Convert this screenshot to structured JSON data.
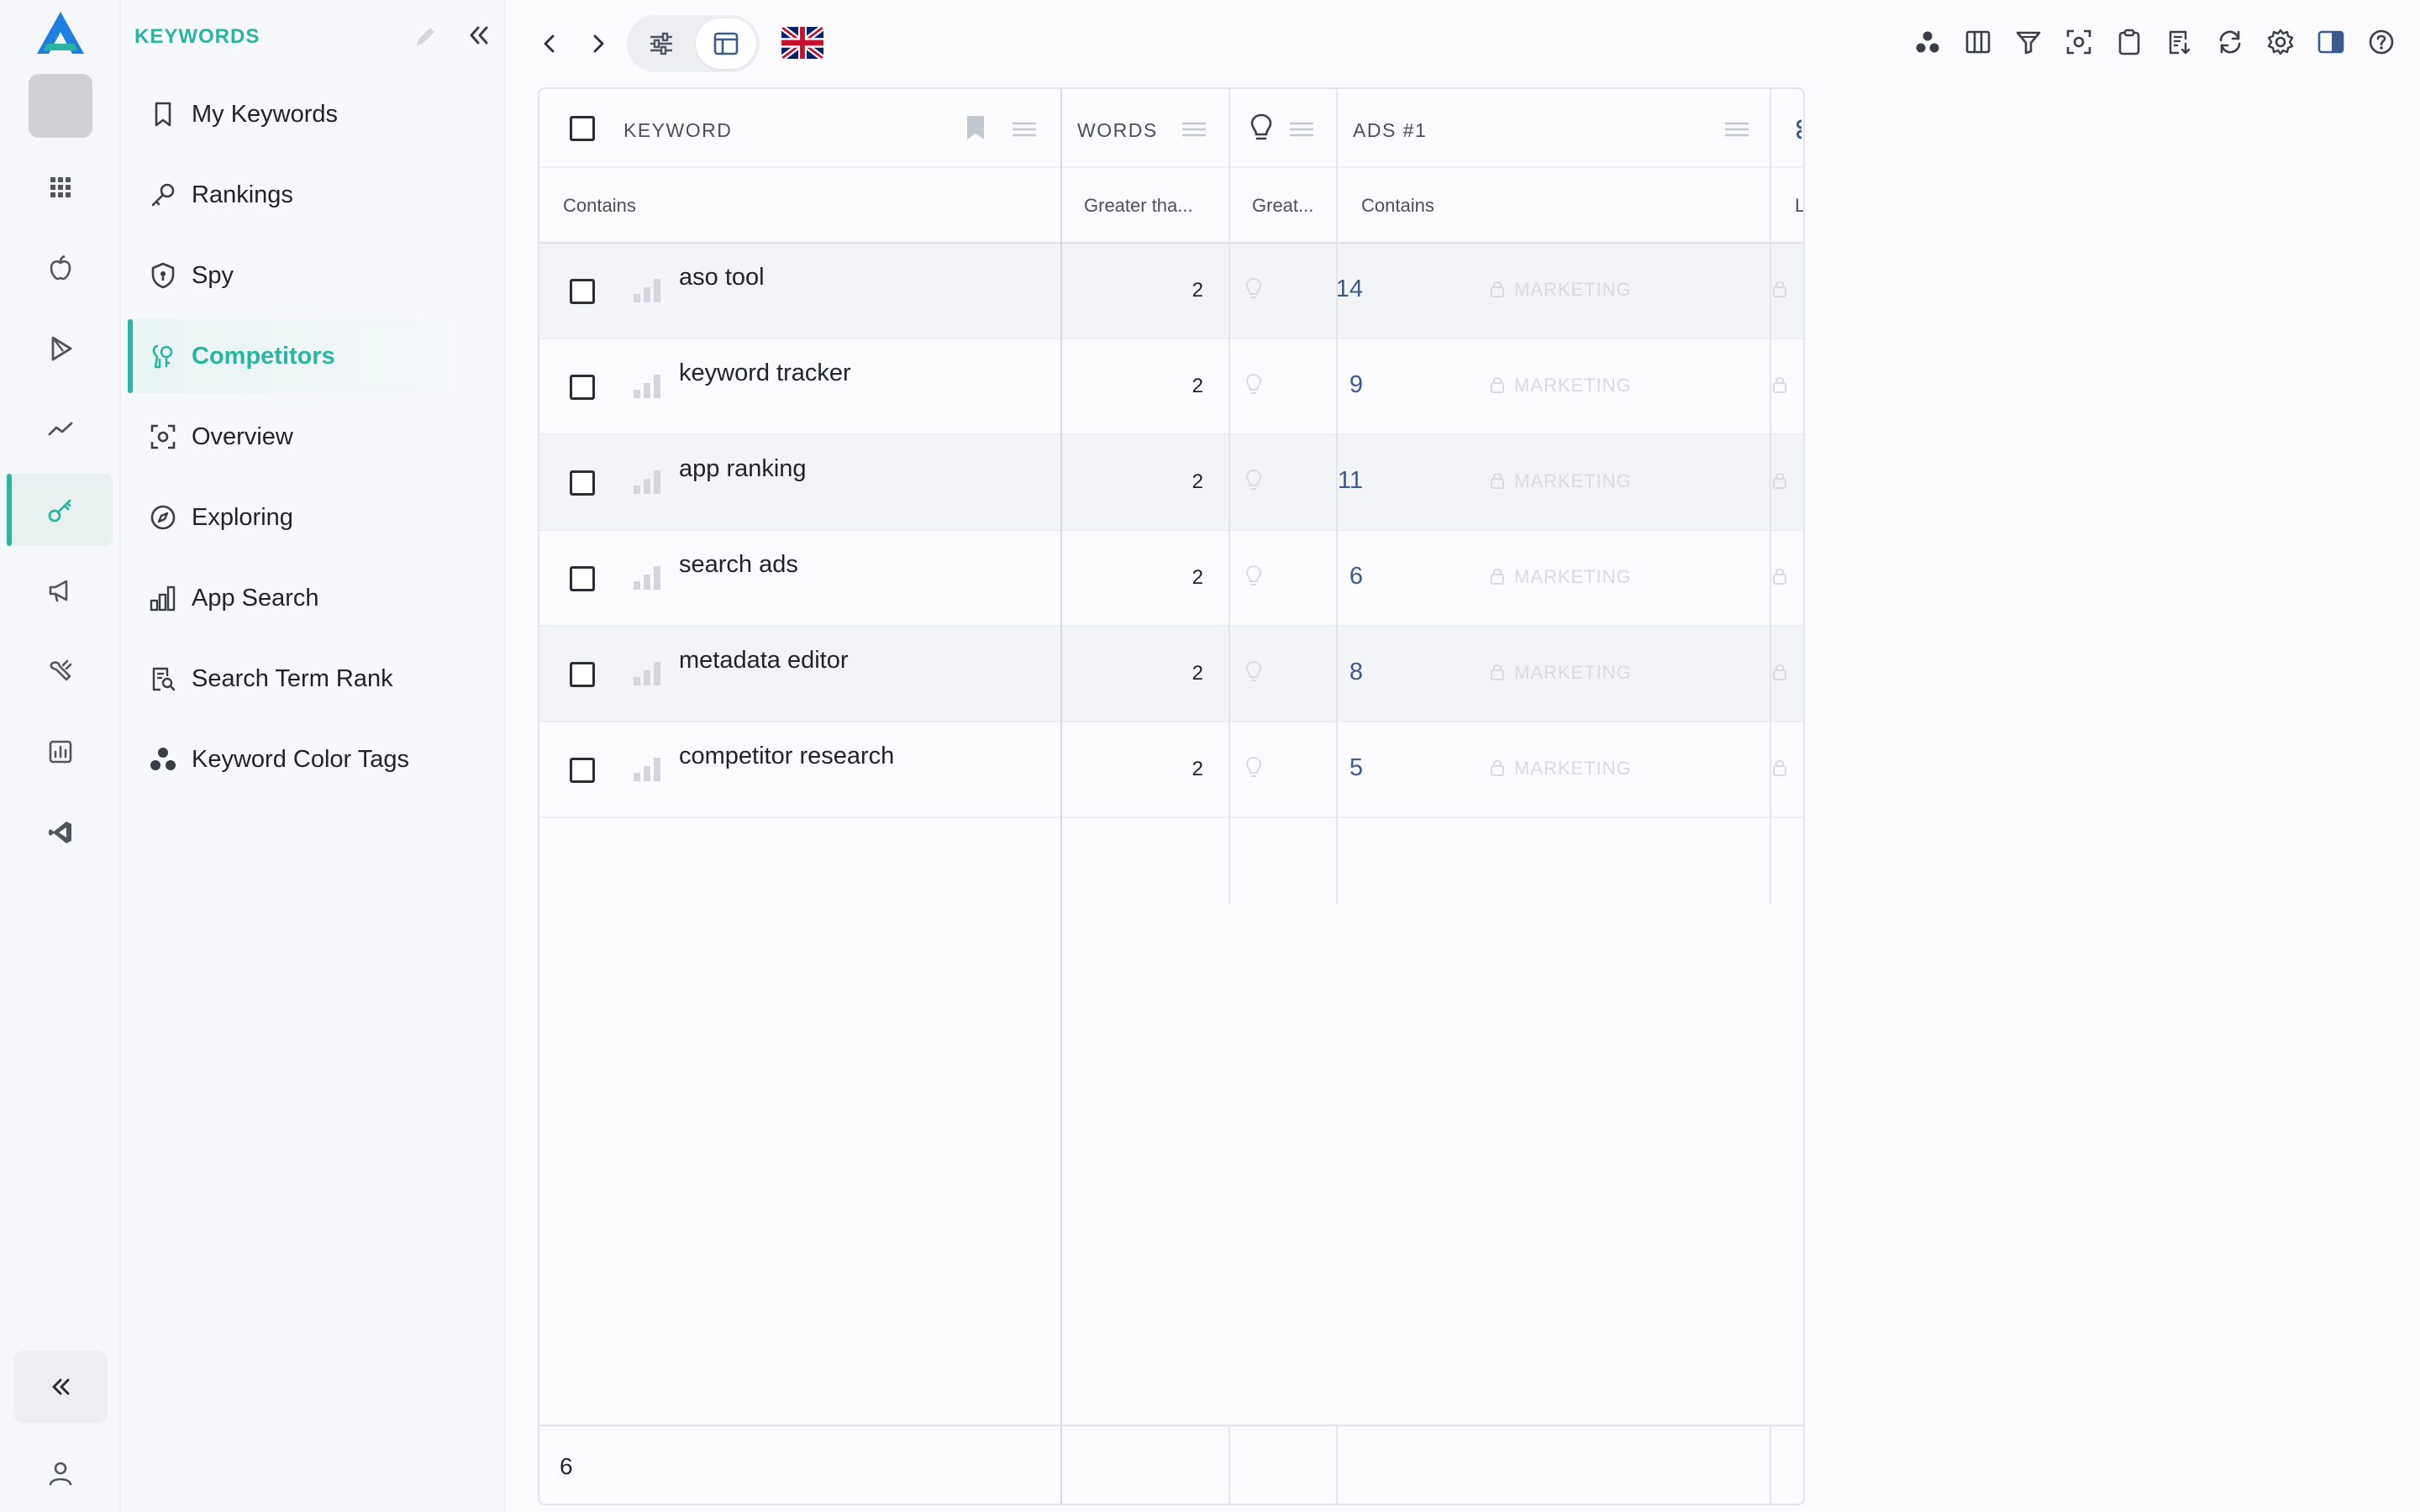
{
  "sidebar": {
    "title": "KEYWORDS",
    "items": [
      {
        "label": "My Keywords"
      },
      {
        "label": "Rankings"
      },
      {
        "label": "Spy"
      },
      {
        "label": "Competitors"
      },
      {
        "label": "Overview"
      },
      {
        "label": "Exploring"
      },
      {
        "label": "App Search"
      },
      {
        "label": "Search Term Rank"
      },
      {
        "label": "Keyword Color Tags"
      }
    ]
  },
  "table": {
    "headers": {
      "keyword": "KEYWORD",
      "words": "WORDS",
      "ads": "ADS #1"
    },
    "filters": {
      "keyword": "Contains",
      "words": "Greater tha...",
      "suggestions": "Great...",
      "ads": "Contains",
      "edge": "L"
    },
    "rows": [
      {
        "keyword": "aso tool",
        "words": "2",
        "suggestions": "14",
        "ads": "MARKETING"
      },
      {
        "keyword": "keyword tracker",
        "words": "2",
        "suggestions": "9",
        "ads": "MARKETING"
      },
      {
        "keyword": "app ranking",
        "words": "2",
        "suggestions": "11",
        "ads": "MARKETING"
      },
      {
        "keyword": "search ads",
        "words": "2",
        "suggestions": "6",
        "ads": "MARKETING"
      },
      {
        "keyword": "metadata editor",
        "words": "2",
        "suggestions": "8",
        "ads": "MARKETING"
      },
      {
        "keyword": "competitor research",
        "words": "2",
        "suggestions": "5",
        "ads": "MARKETING"
      }
    ],
    "footer_count": "6"
  },
  "colors": {
    "accent": "#2bb5a0",
    "brand_blue": "#1d7fe0",
    "value_blue": "#3a5a90"
  },
  "icons": {
    "rail": [
      "logo-icon",
      "grid-icon",
      "apple-icon",
      "play-store-icon",
      "trend-icon",
      "key-icon",
      "megaphone-icon",
      "tools-icon",
      "report-icon",
      "vscode-icon",
      "collapse-icon",
      "user-icon"
    ],
    "toolbar_right": [
      "color-tags-icon",
      "columns-icon",
      "filter-icon",
      "focus-icon",
      "clipboard-icon",
      "export-icon",
      "refresh-icon",
      "settings-icon",
      "panel-icon",
      "help-icon"
    ]
  }
}
